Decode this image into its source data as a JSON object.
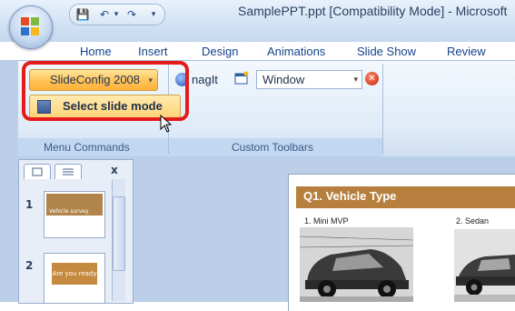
{
  "window": {
    "title": "SamplePPT.ppt [Compatibility Mode] - Microsoft",
    "qat": {
      "save_glyph": "💾",
      "undo_glyph": "↶",
      "undo_arrow": "▾",
      "redo_glyph": "↷",
      "customize_glyph": "▾"
    }
  },
  "tabs": [
    "Home",
    "Insert",
    "Design",
    "Animations",
    "Slide Show",
    "Review"
  ],
  "ribbon": {
    "menu_commands": {
      "label": "Menu Commands",
      "slideconfig_button": "SlideConfig 2008",
      "dropdown_arrow": "▾",
      "menu_item": "Select slide mode"
    },
    "custom_toolbars": {
      "label": "Custom Toolbars",
      "snagit_label": "nagIt",
      "window_value": "Window",
      "select_arrow": "▾",
      "stop_glyph": "✕"
    }
  },
  "slides_panel": {
    "close": "x",
    "thumbnails": [
      {
        "number": "1",
        "title": "Vehicle survey"
      },
      {
        "number": "2",
        "title": "Are you ready"
      }
    ]
  },
  "slide": {
    "title": "Q1. Vehicle Type",
    "options": [
      "1. Mini MVP",
      "2. Sedan"
    ]
  },
  "colors": {
    "highlight": "#e41b1b",
    "accent_orange": "#ffc55a",
    "slide_title_bar": "#b77f3e"
  },
  "icons": [
    "office-logo-icon",
    "save-icon",
    "undo-icon",
    "redo-icon",
    "snagit-icon",
    "window-icon",
    "stop-icon",
    "menu-item-icon",
    "mouse-cursor-icon"
  ]
}
